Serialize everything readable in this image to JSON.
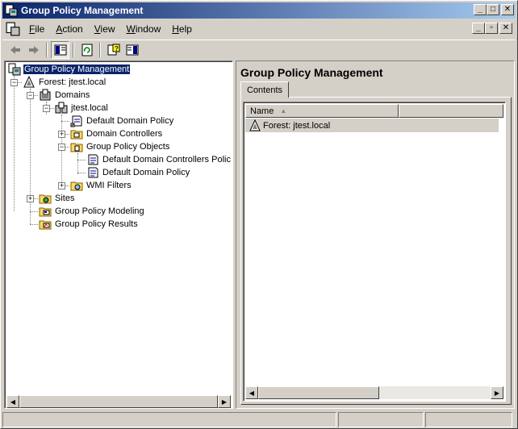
{
  "window": {
    "title": "Group Policy Management"
  },
  "menu": {
    "items": [
      {
        "label": "File",
        "accel": "F"
      },
      {
        "label": "Action",
        "accel": "A"
      },
      {
        "label": "View",
        "accel": "V"
      },
      {
        "label": "Window",
        "accel": "W"
      },
      {
        "label": "Help",
        "accel": "H"
      }
    ]
  },
  "toolbar": {
    "buttons": [
      "back-icon",
      "forward-icon",
      "show-hide-tree-icon",
      "refresh-icon",
      "help-icon",
      "show-hide-action-pane-icon"
    ]
  },
  "tree": {
    "root": "Group Policy Management",
    "forest": "Forest: jtest.local",
    "domains": "Domains",
    "domain": "jtest.local",
    "default_domain_policy": "Default Domain Policy",
    "domain_controllers": "Domain Controllers",
    "gpo_container": "Group Policy Objects",
    "gpo_ddcp": "Default Domain Controllers Policy",
    "gpo_ddp": "Default Domain Policy",
    "wmi_filters": "WMI Filters",
    "sites": "Sites",
    "modeling": "Group Policy Modeling",
    "results": "Group Policy Results"
  },
  "details": {
    "title": "Group Policy Management",
    "tab": "Contents",
    "column_name": "Name",
    "rows": [
      "Forest: jtest.local"
    ]
  },
  "colors": {
    "titlebar_start": "#0a246a",
    "titlebar_end": "#a6caf0",
    "selection": "#0a246a",
    "chrome": "#d4d0c8"
  }
}
